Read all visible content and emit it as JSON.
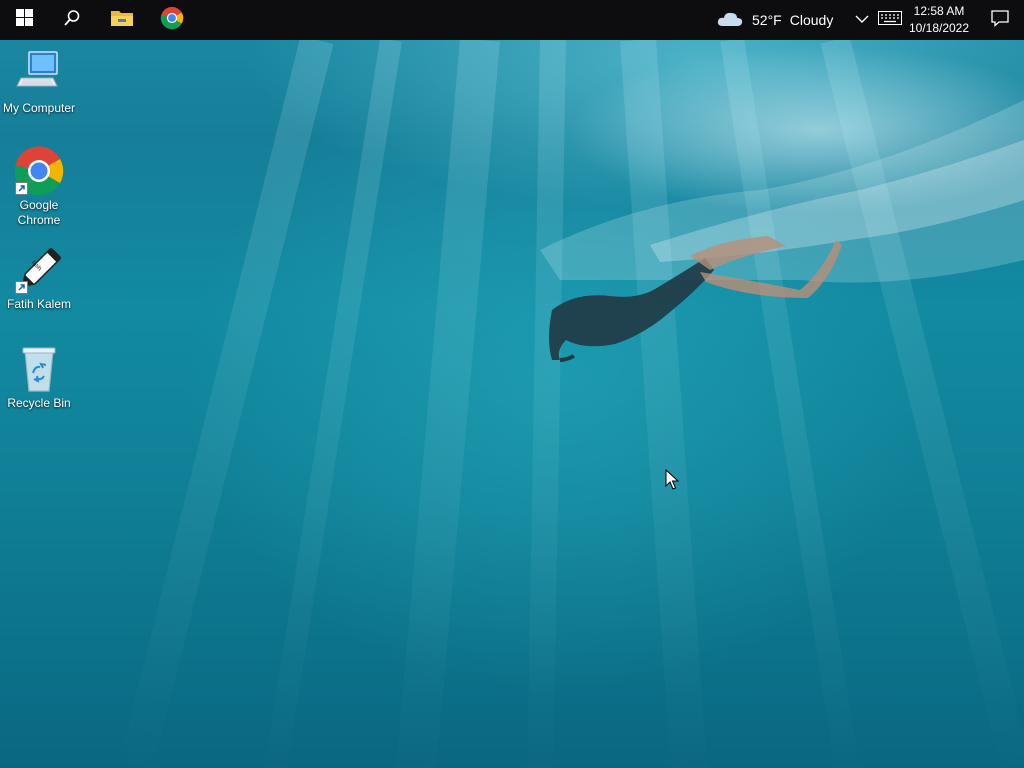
{
  "taskbar": {
    "start_icon": "windows-logo-icon",
    "search_icon": "search-icon",
    "pinned_apps": [
      {
        "name": "File Explorer",
        "icon": "folder-icon"
      },
      {
        "name": "Google Chrome",
        "icon": "chrome-icon"
      }
    ],
    "weather": {
      "icon": "cloud-icon",
      "temperature": "52°F",
      "condition": "Cloudy"
    },
    "tray": {
      "show_hidden_icon": "chevron-up-icon",
      "keyboard_icon": "keyboard-icon",
      "notification_icon": "action-center-icon"
    },
    "clock": {
      "time": "12:58 AM",
      "date": "10/18/2022"
    }
  },
  "desktop": {
    "icons": [
      {
        "label": "My Computer",
        "icon": "computer-icon"
      },
      {
        "label": "Google Chrome",
        "icon": "chrome-icon",
        "shortcut": true
      },
      {
        "label": "Fatih Kalem",
        "icon": "pen-icon",
        "shortcut": true,
        "logo_text": "fatih"
      },
      {
        "label": "Recycle Bin",
        "icon": "recycle-bin-icon"
      }
    ]
  },
  "colors": {
    "taskbar_background": "#0d0d0f",
    "desktop_water": "#128aa1",
    "text": "#ffffff"
  }
}
